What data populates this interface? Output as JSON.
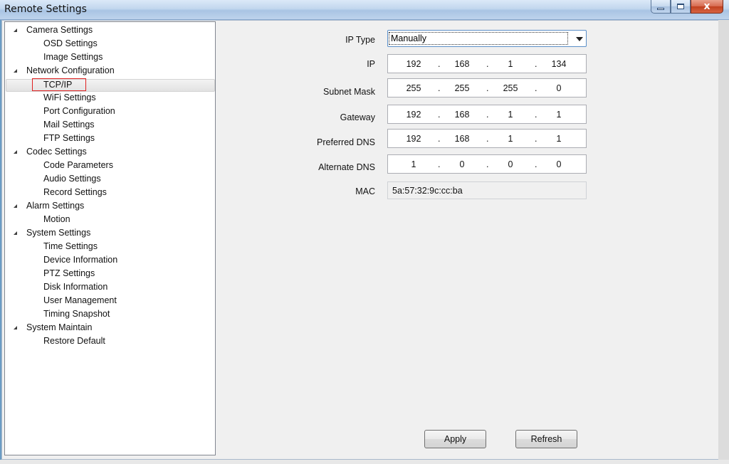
{
  "window": {
    "title": "Remote Settings",
    "controls": {
      "minimize": "",
      "maximize": "",
      "close": "x"
    }
  },
  "tree": {
    "categories": [
      {
        "label": "Camera Settings",
        "children": [
          "OSD Settings",
          "Image Settings"
        ]
      },
      {
        "label": "Network Configuration",
        "children": [
          "TCP/IP",
          "WiFi Settings",
          "Port Configuration",
          "Mail Settings",
          "FTP Settings"
        ]
      },
      {
        "label": "Codec Settings",
        "children": [
          "Code Parameters",
          "Audio Settings",
          "Record Settings"
        ]
      },
      {
        "label": "Alarm Settings",
        "children": [
          "Motion"
        ]
      },
      {
        "label": "System Settings",
        "children": [
          "Time Settings",
          "Device Information",
          "PTZ Settings",
          "Disk Information",
          "User Management",
          "Timing Snapshot"
        ]
      },
      {
        "label": "System Maintain",
        "children": [
          "Restore Default"
        ]
      }
    ],
    "selected": "TCP/IP"
  },
  "form": {
    "ip_type": {
      "label": "IP Type",
      "value": "Manually"
    },
    "ip": {
      "label": "IP",
      "octets": [
        "192",
        "168",
        "1",
        "134"
      ]
    },
    "subnet_mask": {
      "label": "Subnet Mask",
      "octets": [
        "255",
        "255",
        "255",
        "0"
      ]
    },
    "gateway": {
      "label": "Gateway",
      "octets": [
        "192",
        "168",
        "1",
        "1"
      ]
    },
    "preferred_dns": {
      "label": "Preferred DNS",
      "octets": [
        "192",
        "168",
        "1",
        "1"
      ]
    },
    "alternate_dns": {
      "label": "Alternate DNS",
      "octets": [
        "1",
        "0",
        "0",
        "0"
      ]
    },
    "mac": {
      "label": "MAC",
      "value": "5a:57:32:9c:cc:ba"
    }
  },
  "buttons": {
    "apply": "Apply",
    "refresh": "Refresh"
  },
  "colors": {
    "selection_outline": "#e02020",
    "focus_border": "#5b8fc8"
  }
}
